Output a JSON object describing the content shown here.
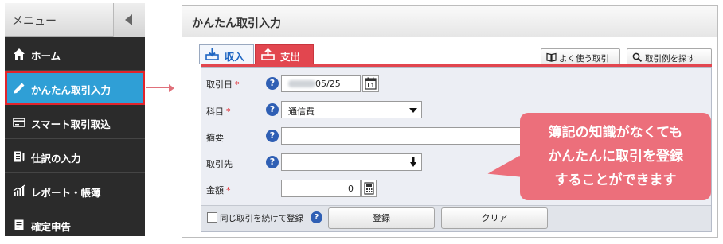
{
  "sidebar": {
    "title": "メニュー",
    "items": [
      {
        "label": "ホーム",
        "icon": "home-icon"
      },
      {
        "label": "かんたん取引入力",
        "icon": "pencil-icon",
        "active": true
      },
      {
        "label": "スマート取引取込",
        "icon": "card-import-icon"
      },
      {
        "label": "仕訳の入力",
        "icon": "journal-icon"
      },
      {
        "label": "レポート・帳簿",
        "icon": "bar-chart-icon"
      },
      {
        "label": "確定申告",
        "icon": "document-icon"
      }
    ]
  },
  "panel": {
    "title": "かんたん取引入力",
    "tabs": [
      {
        "label": "収入",
        "icon": "income-icon"
      },
      {
        "label": "支出",
        "icon": "expense-icon",
        "active": true
      }
    ],
    "header_buttons": {
      "often_used": "よく使う取引",
      "examples": "取引例を探す"
    },
    "form": {
      "date": {
        "label": "取引日",
        "required": "*",
        "value": "05/25"
      },
      "subject": {
        "label": "科目",
        "required": "*",
        "value": "通信費"
      },
      "memo": {
        "label": "摘要",
        "value": ""
      },
      "partner": {
        "label": "取引先",
        "value": ""
      },
      "amount": {
        "label": "金額",
        "required": "*",
        "value": "0"
      },
      "help_glyph": "?"
    },
    "footer": {
      "continue_label": "同じ取引を続けて登録",
      "continue_checked": false,
      "register_label": "登録",
      "clear_label": "クリア"
    }
  },
  "callout": {
    "lines": [
      "簿記の知識がなくても",
      "かんたんに取引を登録",
      "することができます"
    ]
  },
  "colors": {
    "sidebar_bg": "#2b2b2b",
    "active_item": "#2f9fd6",
    "highlight_border": "#e2242b",
    "expense_tab": "#e2464f",
    "help_icon": "#2f5fb4",
    "callout_bg": "#ec6f7b"
  }
}
